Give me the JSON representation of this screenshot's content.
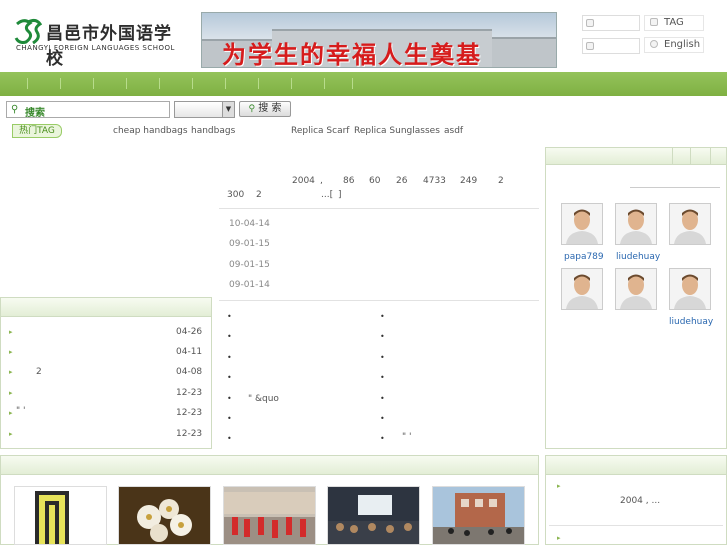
{
  "header": {
    "logo_cn": "昌邑市外国语学校",
    "logo_en": "CHANGYI FOREIGN LANGUAGES SCHOOL",
    "banner_slogan": "为学生的幸福人生奠基",
    "quick_links": [
      "TAG",
      "English"
    ]
  },
  "search": {
    "placeholder": "搜索",
    "button": "搜 索"
  },
  "tags": {
    "label": "热门TAG",
    "items": [
      "cheap handbags",
      "handbags",
      "Replica Scarf",
      "Replica Sunglasses",
      "asdf"
    ]
  },
  "stats": {
    "line1": [
      "2004",
      ",",
      "86",
      "60",
      "26",
      "4733",
      "249",
      "2"
    ],
    "line2": [
      "300",
      "2",
      "...[",
      "]"
    ]
  },
  "date_list": [
    "10-04-14",
    "09-01-15",
    "09-01-15",
    "09-01-14"
  ],
  "left_list": [
    {
      "text": "",
      "date": "04-26"
    },
    {
      "text": "",
      "date": "04-11"
    },
    {
      "text": "2",
      "date": "04-08"
    },
    {
      "text": "",
      "date": "12-23"
    },
    {
      "text": "\"        '",
      "date": "12-23"
    },
    {
      "text": "",
      "date": "12-23"
    }
  ],
  "middle_bullets_left": [
    "",
    "",
    "",
    "",
    "\"     &quo",
    "",
    ""
  ],
  "middle_bullets_right": [
    "",
    "",
    "",
    "",
    "",
    "",
    "\"  '"
  ],
  "members": [
    {
      "name": "papa789"
    },
    {
      "name": "liudehuay"
    },
    {
      "name": ""
    },
    {
      "name": ""
    },
    {
      "name": ""
    },
    {
      "name": "liudehuay"
    }
  ],
  "bottom_right": {
    "text": "2004    ,       ..."
  },
  "colors": {
    "nav_green": "#8abd4f",
    "tag_green": "#4a8f1c",
    "link_blue": "#2b68b0",
    "slogan_red": "#d61c1c"
  }
}
